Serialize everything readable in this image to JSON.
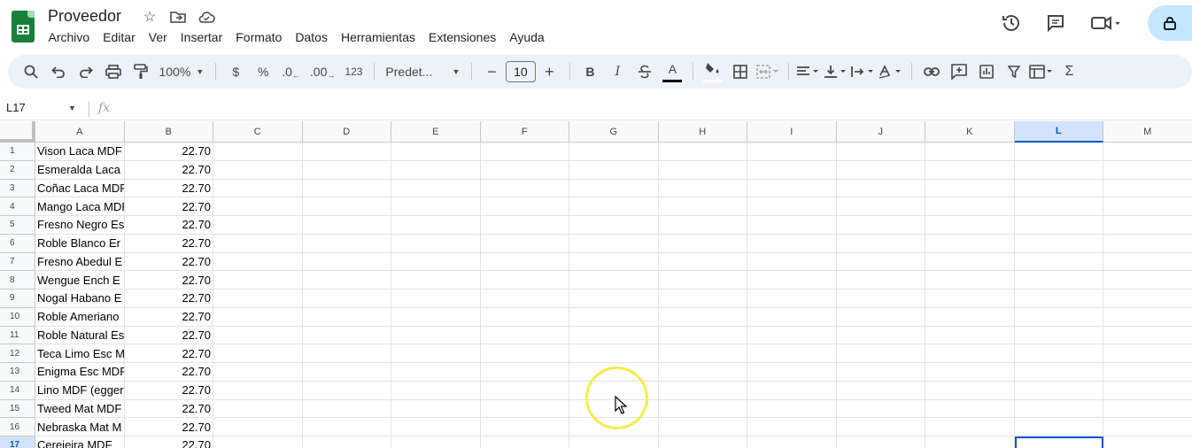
{
  "document": {
    "title": "Proveedor"
  },
  "menubar": [
    "Archivo",
    "Editar",
    "Ver",
    "Insertar",
    "Formato",
    "Datos",
    "Herramientas",
    "Extensiones",
    "Ayuda"
  ],
  "toolbar": {
    "zoom": "100%",
    "currency": "$",
    "percent": "%",
    "decrease_decimals": ".0",
    "increase_decimals": ".00",
    "more_formats": "123",
    "font": "Predet...",
    "font_size": "10",
    "decrease_font": "−",
    "increase_font": "+",
    "bold": "B",
    "italic": "I",
    "text_color": "A",
    "function": "Σ"
  },
  "formula_bar": {
    "name_box": "L17",
    "fx_label": "fx"
  },
  "grid": {
    "columns": [
      "A",
      "B",
      "C",
      "D",
      "E",
      "F",
      "G",
      "H",
      "I",
      "J",
      "K",
      "L",
      "M"
    ],
    "selected_column": "L",
    "selected_row": "17",
    "rows": [
      {
        "n": "1",
        "a": "Vison Laca MDF",
        "b": "22.70"
      },
      {
        "n": "2",
        "a": "Esmeralda Laca",
        "b": "22.70"
      },
      {
        "n": "3",
        "a": "Coñac Laca MDF",
        "b": "22.70"
      },
      {
        "n": "4",
        "a": "Mango Laca MDF",
        "b": "22.70"
      },
      {
        "n": "5",
        "a": "Fresno Negro Es",
        "b": "22.70"
      },
      {
        "n": "6",
        "a": "Roble Blanco Er",
        "b": "22.70"
      },
      {
        "n": "7",
        "a": "Fresno Abedul E",
        "b": "22.70"
      },
      {
        "n": "8",
        "a": "Wengue Ench E",
        "b": "22.70"
      },
      {
        "n": "9",
        "a": "Nogal Habano E",
        "b": "22.70"
      },
      {
        "n": "10",
        "a": "Roble Ameriano",
        "b": "22.70"
      },
      {
        "n": "11",
        "a": "Roble Natural Es",
        "b": "22.70"
      },
      {
        "n": "12",
        "a": "Teca Limo Esc M",
        "b": "22.70"
      },
      {
        "n": "13",
        "a": "Enigma Esc MDF",
        "b": "22.70"
      },
      {
        "n": "14",
        "a": "Lino MDF (egger",
        "b": "22.70"
      },
      {
        "n": "15",
        "a": "Tweed Mat MDF",
        "b": "22.70"
      },
      {
        "n": "16",
        "a": "Nebraska Mat M",
        "b": "22.70"
      },
      {
        "n": "17",
        "a": "Cereieira MDF",
        "b": "22.70"
      }
    ]
  },
  "colors": {
    "accent": "#0b57d0",
    "selection_bg": "#d3e3fd",
    "toolbar_bg": "#edf2fa",
    "share_bg": "#c2e7ff",
    "cursor_ring": "#f5ee4a"
  }
}
